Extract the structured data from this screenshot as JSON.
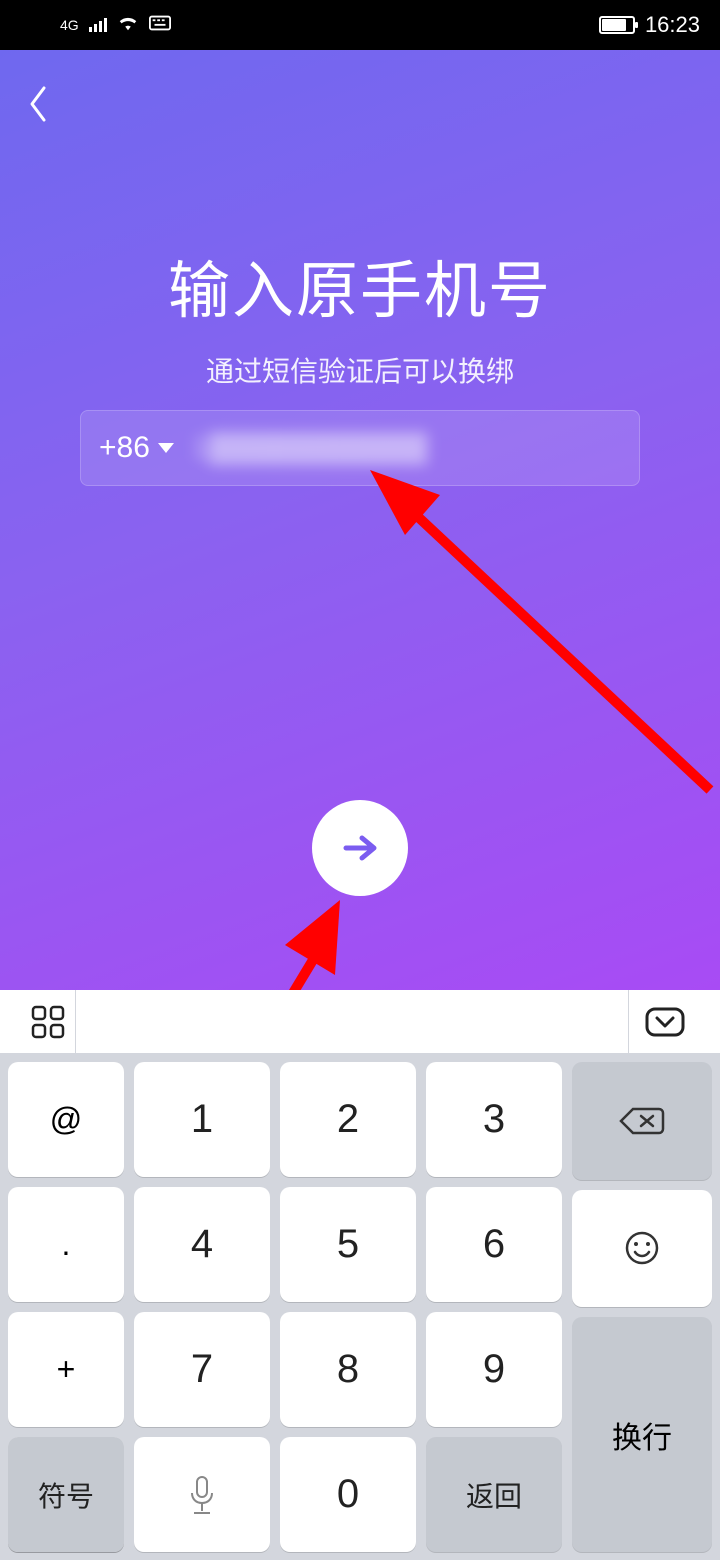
{
  "status": {
    "network": "4G",
    "time": "16:23"
  },
  "nav": {
    "back_icon": "chevron-left"
  },
  "page": {
    "title": "输入原手机号",
    "subtitle": "通过短信验证后可以换绑"
  },
  "phone": {
    "country_code": "+86",
    "value": "1▓▓▓▓▓▓▓▓▓▓"
  },
  "submit": {
    "icon": "arrow-right"
  },
  "keyboard": {
    "left_syms": [
      "@",
      ".",
      "+",
      "-"
    ],
    "digits": [
      "1",
      "2",
      "3",
      "4",
      "5",
      "6",
      "7",
      "8",
      "9",
      "0"
    ],
    "sym_label": "符号",
    "return_label": "返回",
    "enter_label": "换行"
  },
  "annotations": {
    "arrow_color": "#ff0000"
  }
}
